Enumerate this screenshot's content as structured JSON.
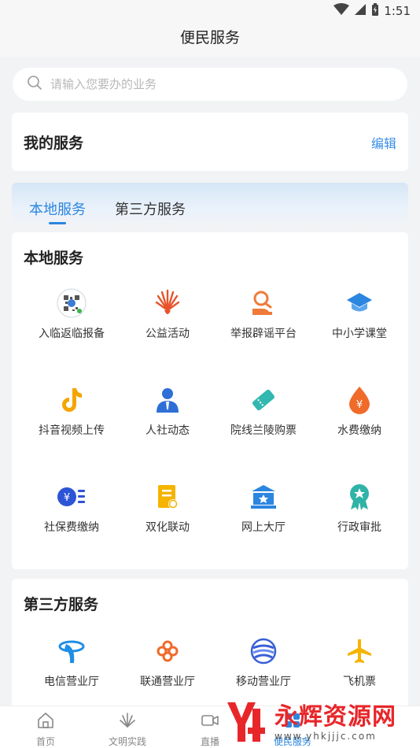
{
  "status": {
    "time": "1:51"
  },
  "header": {
    "title": "便民服务"
  },
  "search": {
    "placeholder": "请输入您要办的业务"
  },
  "my_service": {
    "title": "我的服务",
    "edit_label": "编辑"
  },
  "tabs": [
    {
      "label": "本地服务",
      "active": true
    },
    {
      "label": "第三方服务",
      "active": false
    }
  ],
  "local": {
    "title": "本地服务",
    "items": [
      {
        "label": "入临返临报备",
        "icon": "qr-code-icon"
      },
      {
        "label": "公益活动",
        "icon": "fan-icon"
      },
      {
        "label": "举报辟谣平台",
        "icon": "report-icon"
      },
      {
        "label": "中小学课堂",
        "icon": "graduation-cap-icon"
      },
      {
        "label": "抖音视频上传",
        "icon": "tiktok-icon"
      },
      {
        "label": "人社动态",
        "icon": "person-icon"
      },
      {
        "label": "院线兰陵购票",
        "icon": "ticket-icon"
      },
      {
        "label": "水费缴纳",
        "icon": "water-drop-icon"
      },
      {
        "label": "社保费缴纳",
        "icon": "yuan-coin-icon"
      },
      {
        "label": "双化联动",
        "icon": "document-icon"
      },
      {
        "label": "网上大厅",
        "icon": "hall-icon"
      },
      {
        "label": "行政审批",
        "icon": "badge-icon"
      }
    ]
  },
  "third": {
    "title": "第三方服务",
    "items": [
      {
        "label": "电信营业厅",
        "icon": "telecom-icon"
      },
      {
        "label": "联通营业厅",
        "icon": "unicom-icon"
      },
      {
        "label": "移动营业厅",
        "icon": "mobile-icon"
      },
      {
        "label": "飞机票",
        "icon": "airplane-icon"
      }
    ]
  },
  "bottom_nav": [
    {
      "label": "首页",
      "icon": "home-icon"
    },
    {
      "label": "文明实践",
      "icon": "flower-icon"
    },
    {
      "label": "直播",
      "icon": "video-icon"
    },
    {
      "label": "便民服务",
      "icon": "service-icon",
      "active": true
    }
  ],
  "watermark": {
    "text": "永辉资源网",
    "url": "www.yhkjjjc.com"
  },
  "colors": {
    "accent": "#2b86e0",
    "background": "#f2f3f5"
  }
}
